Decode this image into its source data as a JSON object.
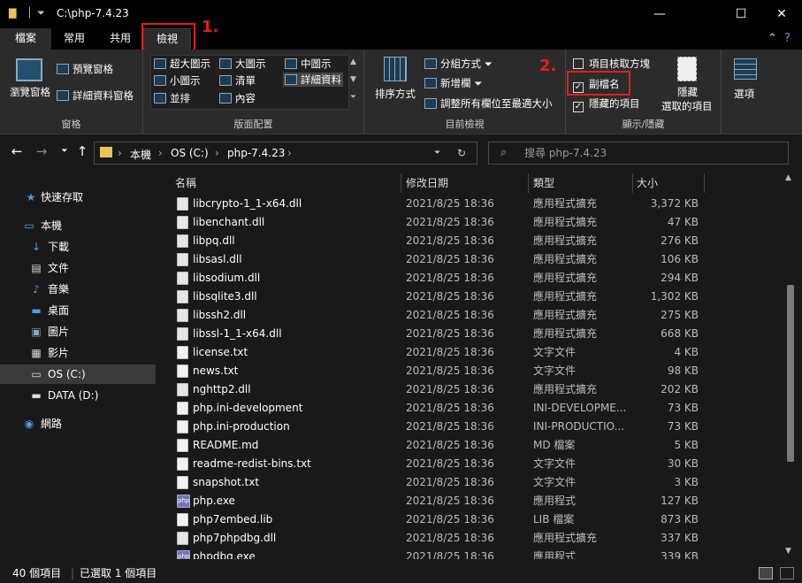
{
  "window": {
    "title": "C:\\php-7.4.23",
    "minimize": "—",
    "maximize": "☐",
    "close": "✕"
  },
  "tabs": {
    "file": "檔案",
    "home": "常用",
    "share": "共用",
    "view": "檢視"
  },
  "ribbon": {
    "panes": {
      "nav_pane": "瀏覽窗格",
      "preview_pane": "預覽窗格",
      "details_pane": "詳細資料窗格",
      "label": "窗格"
    },
    "layout": {
      "extra_large": "超大圖示",
      "large": "大圖示",
      "medium": "中圖示",
      "small": "小圖示",
      "list": "清單",
      "details": "詳細資料",
      "tiles": "並排",
      "content": "內容",
      "label": "版面配置"
    },
    "current_view": {
      "sort_by": "排序方式",
      "group_by": "分組方式",
      "add_columns": "新增欄",
      "size_all_columns": "調整所有欄位至最適大小",
      "label": "目前檢視"
    },
    "show_hide": {
      "item_checkboxes": "項目核取方塊",
      "file_extensions": "副檔名",
      "hidden_items": "隱藏的項目",
      "hide_selected_line1": "隱藏",
      "hide_selected_line2": "選取的項目",
      "label": "顯示/隱藏"
    },
    "options": "選項"
  },
  "annotations": {
    "step1": "1.",
    "step2": "2."
  },
  "address": {
    "crumbs": [
      "本機",
      "OS (C:)",
      "php-7.4.23"
    ],
    "search_placeholder": "搜尋 php-7.4.23"
  },
  "nav": {
    "quick_access": "快速存取",
    "this_pc": "本機",
    "downloads": "下載",
    "documents": "文件",
    "music": "音樂",
    "desktop": "桌面",
    "pictures": "圖片",
    "videos": "影片",
    "os_c": "OS (C:)",
    "data_d": "DATA (D:)",
    "network": "網路"
  },
  "columns": {
    "name": "名稱",
    "date": "修改日期",
    "type": "類型",
    "size": "大小"
  },
  "files": [
    {
      "name": "libcrypto-1_1-x64.dll",
      "date": "2021/8/25 18:36",
      "type": "應用程式擴充",
      "size": "3,372 KB",
      "icon": "dll"
    },
    {
      "name": "libenchant.dll",
      "date": "2021/8/25 18:36",
      "type": "應用程式擴充",
      "size": "47 KB",
      "icon": "dll"
    },
    {
      "name": "libpq.dll",
      "date": "2021/8/25 18:36",
      "type": "應用程式擴充",
      "size": "276 KB",
      "icon": "dll"
    },
    {
      "name": "libsasl.dll",
      "date": "2021/8/25 18:36",
      "type": "應用程式擴充",
      "size": "106 KB",
      "icon": "dll"
    },
    {
      "name": "libsodium.dll",
      "date": "2021/8/25 18:36",
      "type": "應用程式擴充",
      "size": "294 KB",
      "icon": "dll"
    },
    {
      "name": "libsqlite3.dll",
      "date": "2021/8/25 18:36",
      "type": "應用程式擴充",
      "size": "1,302 KB",
      "icon": "dll"
    },
    {
      "name": "libssh2.dll",
      "date": "2021/8/25 18:36",
      "type": "應用程式擴充",
      "size": "275 KB",
      "icon": "dll"
    },
    {
      "name": "libssl-1_1-x64.dll",
      "date": "2021/8/25 18:36",
      "type": "應用程式擴充",
      "size": "668 KB",
      "icon": "dll"
    },
    {
      "name": "license.txt",
      "date": "2021/8/25 18:36",
      "type": "文字文件",
      "size": "4 KB",
      "icon": "txt"
    },
    {
      "name": "news.txt",
      "date": "2021/8/25 18:36",
      "type": "文字文件",
      "size": "98 KB",
      "icon": "txt"
    },
    {
      "name": "nghttp2.dll",
      "date": "2021/8/25 18:36",
      "type": "應用程式擴充",
      "size": "202 KB",
      "icon": "dll"
    },
    {
      "name": "php.ini-development",
      "date": "2021/8/25 18:36",
      "type": "INI-DEVELOPME...",
      "size": "73 KB",
      "icon": "txt"
    },
    {
      "name": "php.ini-production",
      "date": "2021/8/25 18:36",
      "type": "INI-PRODUCTIO...",
      "size": "73 KB",
      "icon": "txt"
    },
    {
      "name": "README.md",
      "date": "2021/8/25 18:36",
      "type": "MD 檔案",
      "size": "5 KB",
      "icon": "txt"
    },
    {
      "name": "readme-redist-bins.txt",
      "date": "2021/8/25 18:36",
      "type": "文字文件",
      "size": "30 KB",
      "icon": "txt"
    },
    {
      "name": "snapshot.txt",
      "date": "2021/8/25 18:36",
      "type": "文字文件",
      "size": "3 KB",
      "icon": "txt"
    },
    {
      "name": "php.exe",
      "date": "2021/8/25 18:36",
      "type": "應用程式",
      "size": "127 KB",
      "icon": "exe"
    },
    {
      "name": "php7embed.lib",
      "date": "2021/8/25 18:36",
      "type": "LIB 檔案",
      "size": "873 KB",
      "icon": "txt"
    },
    {
      "name": "php7phpdbg.dll",
      "date": "2021/8/25 18:36",
      "type": "應用程式擴充",
      "size": "337 KB",
      "icon": "dll"
    },
    {
      "name": "phpdbg.exe",
      "date": "2021/8/25 18:36",
      "type": "應用程式",
      "size": "339 KB",
      "icon": "exe"
    }
  ],
  "status": {
    "count": "40 個項目",
    "selected": "已選取 1 個項目"
  },
  "colors": {
    "accent": "#e0201a",
    "background": "#191919"
  }
}
